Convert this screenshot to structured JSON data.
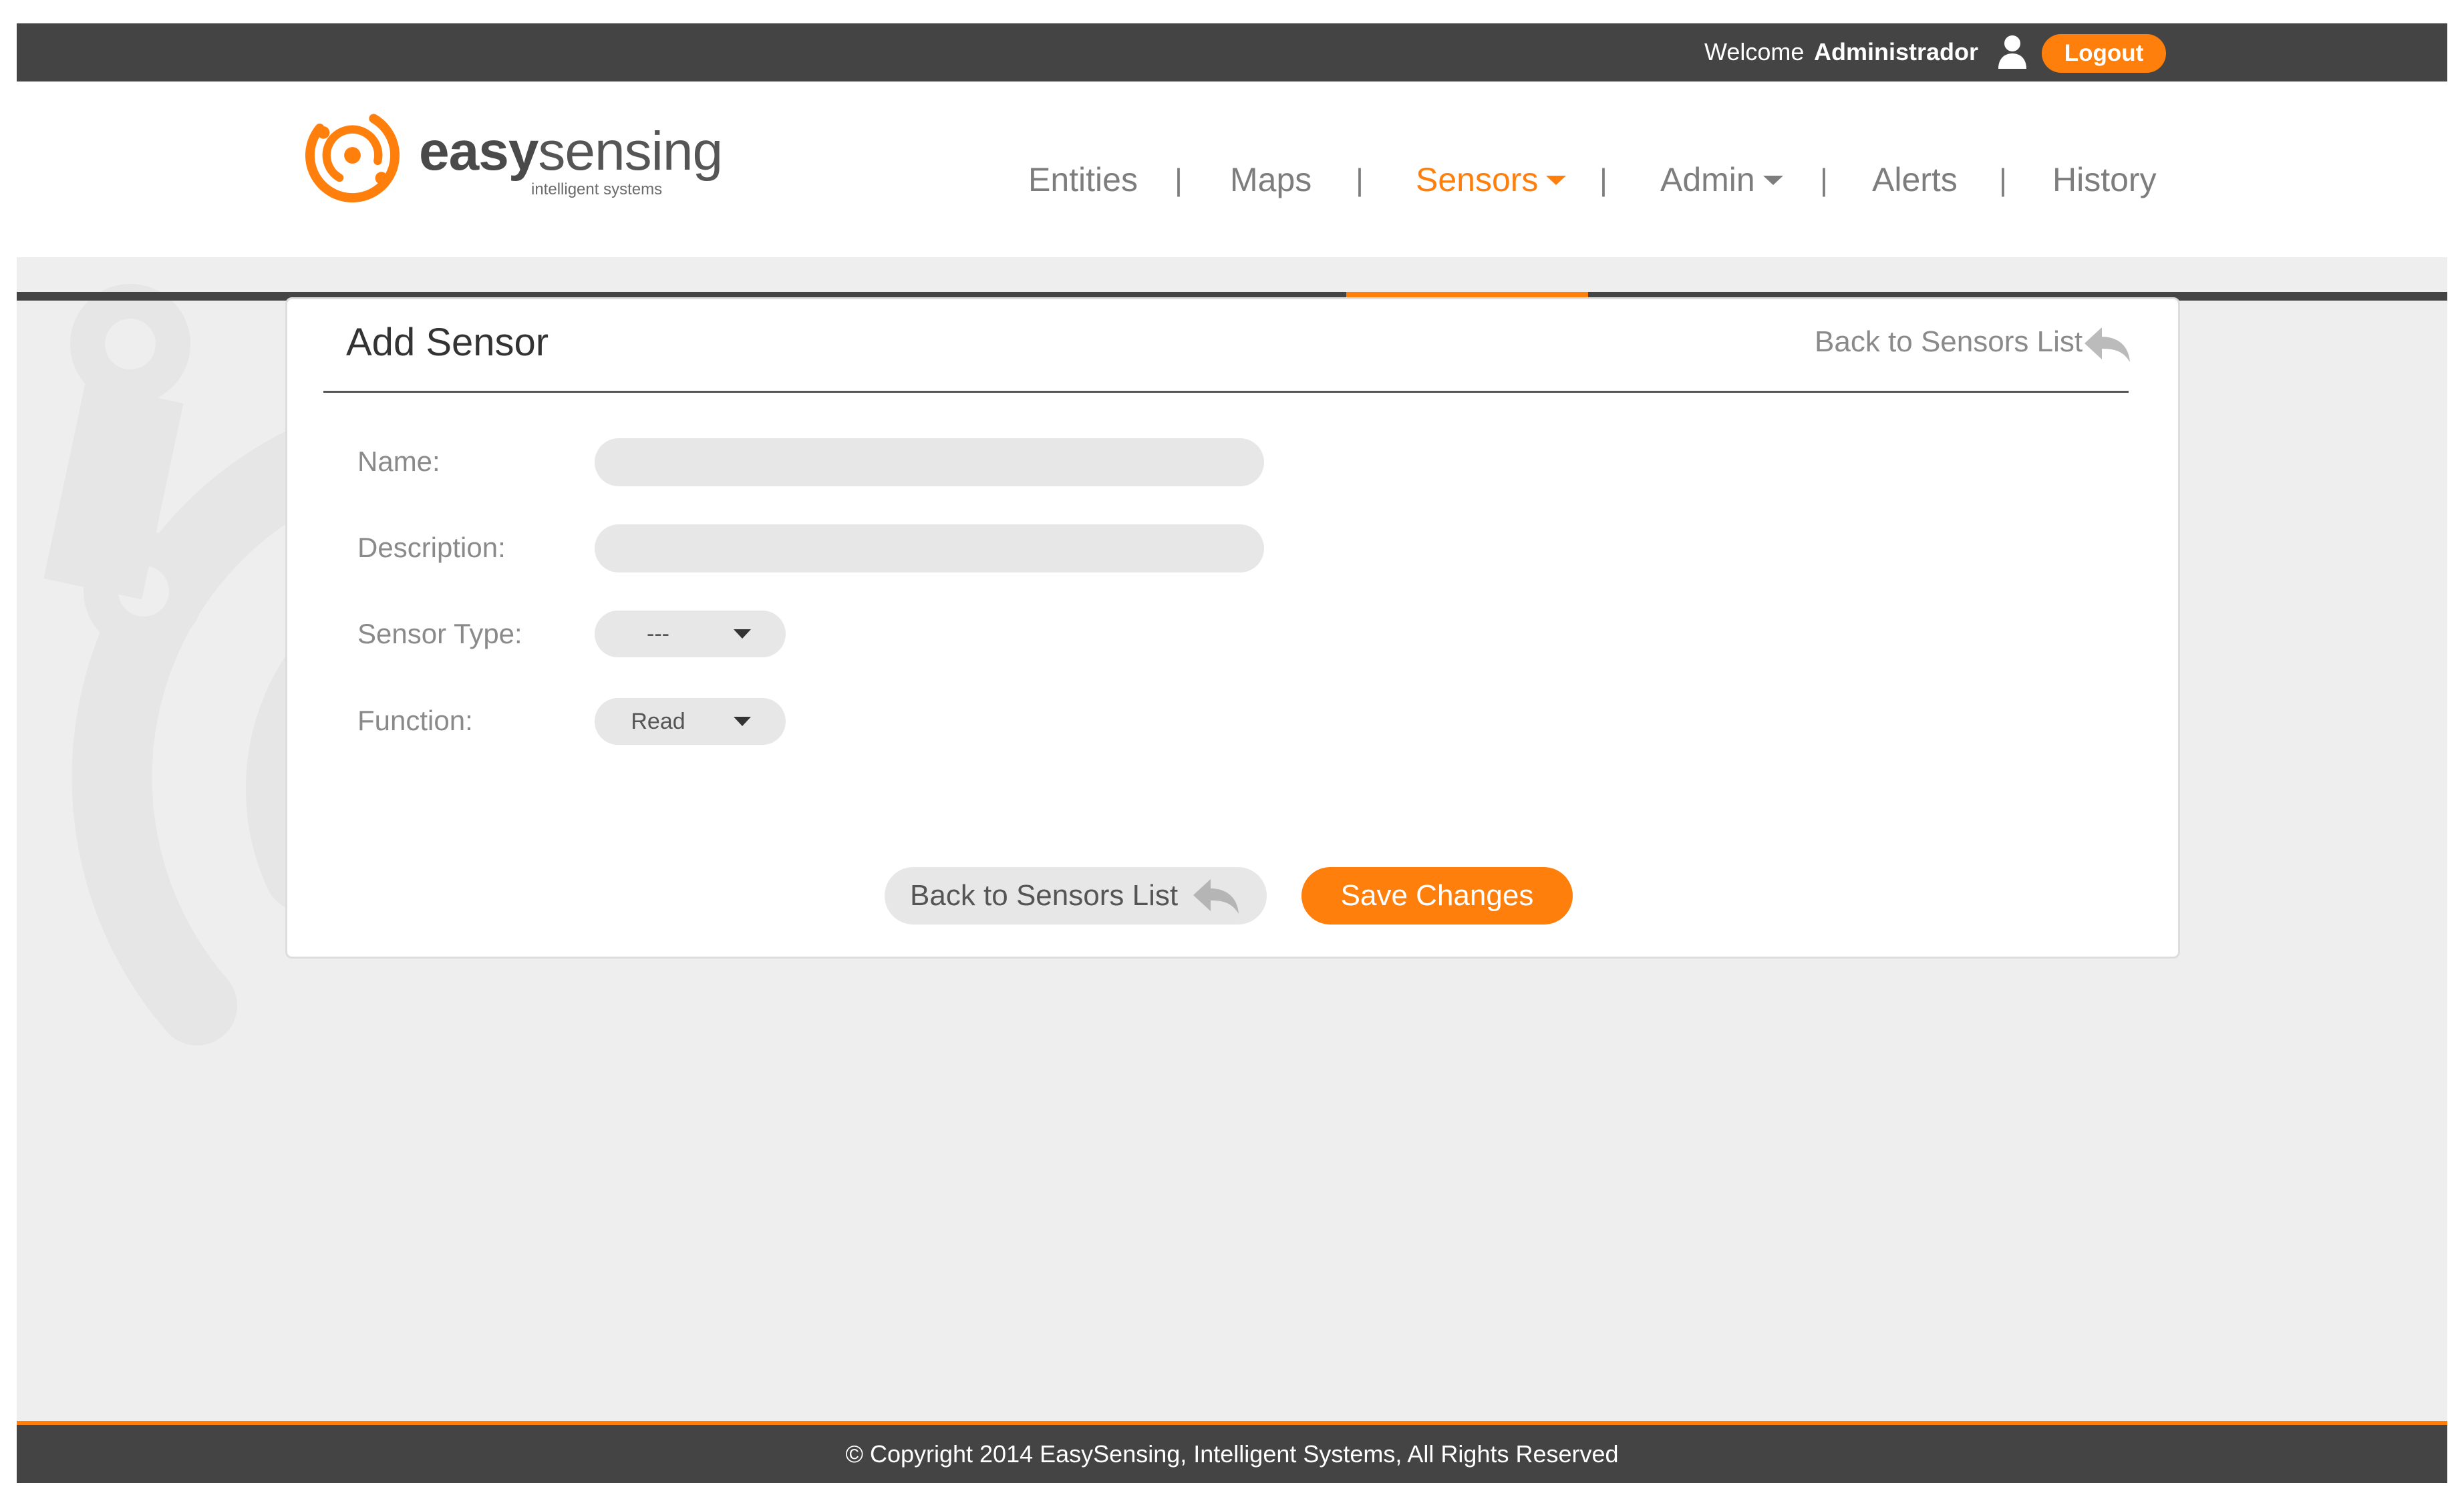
{
  "topbar": {
    "welcome_label": "Welcome",
    "user_name": "Administrador",
    "logout_label": "Logout"
  },
  "brand": {
    "name_bold": "easy",
    "name_regular": "sensing",
    "tagline": "intelligent systems"
  },
  "nav": {
    "items": [
      {
        "label": "Entities"
      },
      {
        "label": "Maps"
      },
      {
        "label": "Sensors",
        "active": true,
        "has_dropdown": true
      },
      {
        "label": "Admin",
        "has_dropdown": true
      },
      {
        "label": "Alerts"
      },
      {
        "label": "History"
      }
    ],
    "separator": "|"
  },
  "form": {
    "title": "Add Sensor",
    "back_link": "Back to Sensors List",
    "fields": {
      "name_label": "Name:",
      "name_value": "",
      "description_label": "Description:",
      "description_value": "",
      "sensor_type_label": "Sensor Type:",
      "sensor_type_value": "---",
      "function_label": "Function:",
      "function_value": "Read"
    },
    "back_button": "Back to Sensors List",
    "save_button": "Save Changes"
  },
  "footer": {
    "copyright": "© Copyright 2014 EasySensing, Intelligent Systems, All Rights Reserved"
  },
  "colors": {
    "accent": "#ff7f0c",
    "bar": "#444444",
    "background": "#eeeeee",
    "field": "#e7e7e7"
  },
  "icons": [
    "user-icon",
    "logo-icon",
    "caret-down-icon",
    "back-arrow-icon"
  ]
}
